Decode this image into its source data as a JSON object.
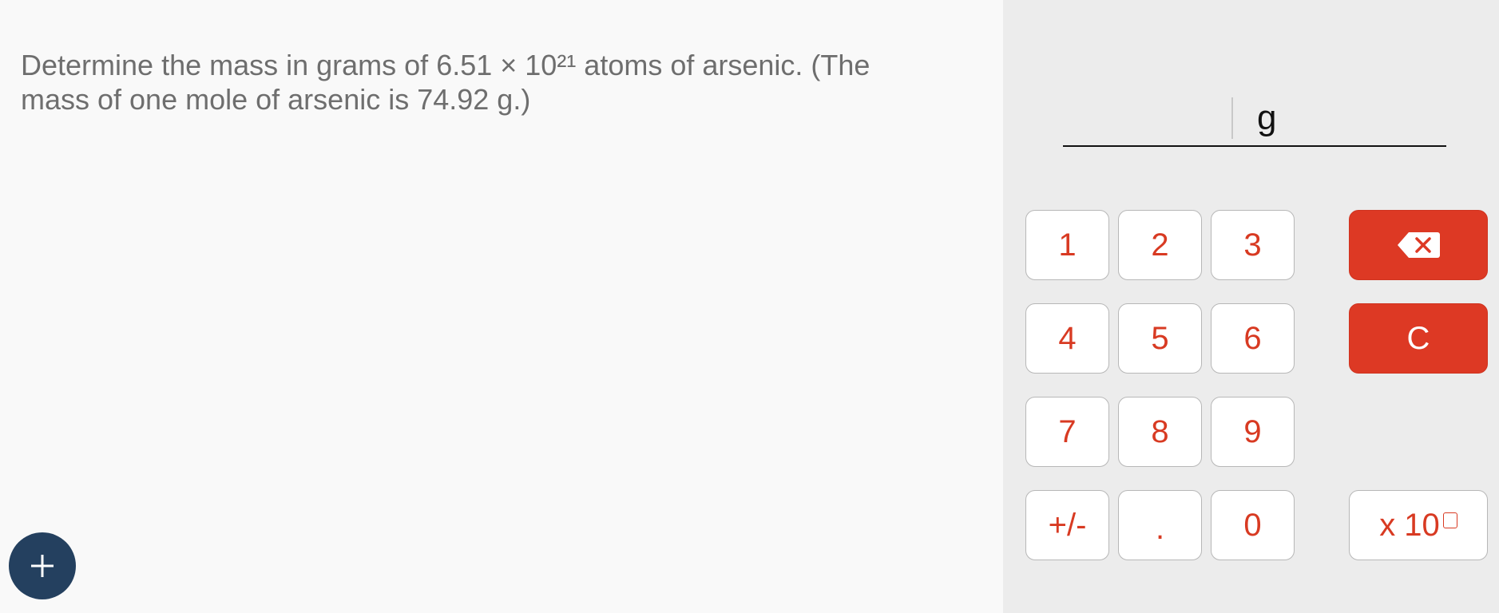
{
  "question": {
    "text": "Determine the mass in grams of 6.51 × 10²¹ atoms of arsenic. (The mass of one mole of arsenic is 74.92 g.)"
  },
  "answer": {
    "value": "",
    "unit": "g"
  },
  "keypad": {
    "digits": [
      "1",
      "2",
      "3",
      "4",
      "5",
      "6",
      "7",
      "8",
      "9"
    ],
    "sign": "+/-",
    "decimal": ".",
    "zero": "0",
    "clear": "C",
    "exponent": "x 10",
    "backspace_icon": "backspace-icon"
  },
  "fab": {
    "icon": "plus-icon"
  },
  "colors": {
    "accent_red": "#dd3924",
    "fab_navy": "#24405f",
    "key_text": "#d83a22"
  }
}
